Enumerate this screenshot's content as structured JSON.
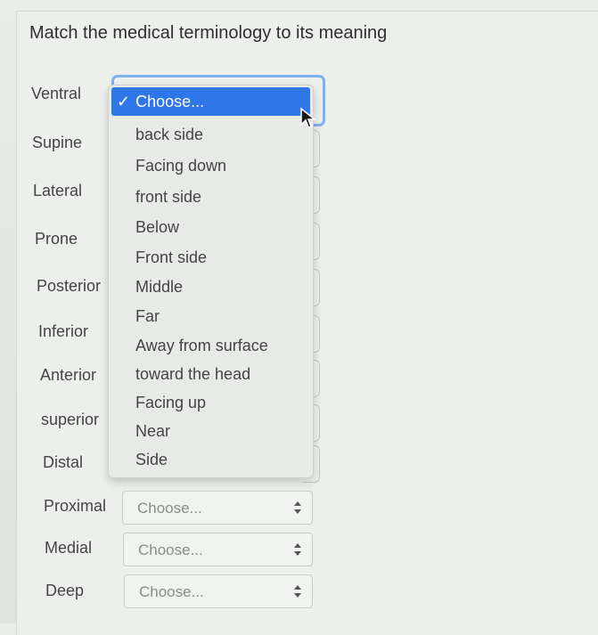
{
  "question": "Match the medical terminology to its meaning",
  "terms": [
    "Ventral",
    "Supine",
    "Lateral",
    "Prone",
    "Posterior",
    "Inferior",
    "Anterior",
    "superior",
    "Distal",
    "Proximal",
    "Medial",
    "Deep"
  ],
  "dropdown": {
    "selected": "Choose...",
    "options": [
      "back side",
      "Facing down",
      "front side",
      "Below",
      "Front side",
      "Middle",
      "Far",
      "Away from surface",
      "toward the head",
      "Facing up",
      "Near",
      "Side"
    ]
  },
  "selects": {
    "proximal": "Choose...",
    "medial": "Choose...",
    "deep": "Choose..."
  },
  "icons": {
    "check": "checkmark-icon",
    "cursor": "mouse-pointer-icon",
    "arrows": "select-arrows-icon"
  }
}
